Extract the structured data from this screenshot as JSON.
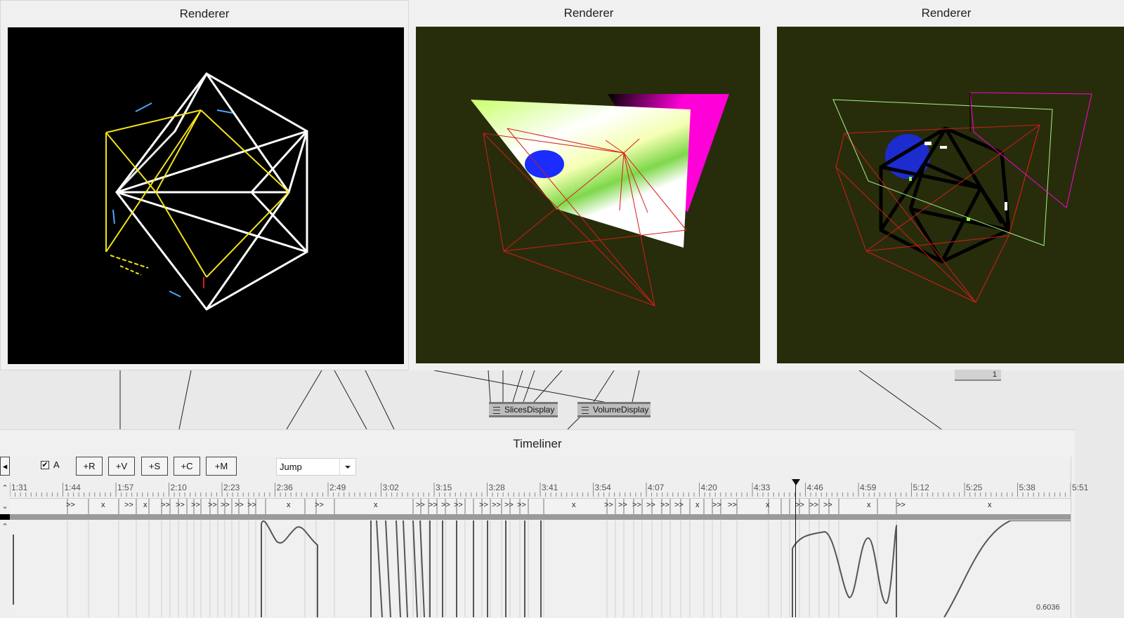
{
  "renderers": [
    {
      "title": "Renderer",
      "background": "#000000"
    },
    {
      "title": "Renderer",
      "background": "#272d0a"
    },
    {
      "title": "Renderer",
      "background": "#272d0a"
    }
  ],
  "nodes": {
    "slices_display": "SlicesDisplay",
    "volume_display": "VolumeDisplay",
    "iobox_value": "1"
  },
  "timeliner": {
    "title": "Timeliner",
    "left_button_icon": "arrow-left-icon",
    "checkbox_label": "A",
    "checkbox_checked": true,
    "buttons": [
      "+R",
      "+V",
      "+S",
      "+C",
      "+M"
    ],
    "interpolation": "Jump",
    "ruler_labels": [
      "1:31",
      "1:44",
      "1:57",
      "2:10",
      "2:23",
      "2:36",
      "2:49",
      "3:02",
      "3:15",
      "3:28",
      "3:41",
      "3:54",
      "4:07",
      "4:20",
      "4:33",
      "4:46",
      "4:59",
      "5:12",
      "5:25",
      "5:38",
      "5:51"
    ],
    "value_readout": "0.6036"
  },
  "colors": {
    "accent_red": "#d41c1c",
    "yellow_edges": "#f2e21a",
    "magenta_slice": "#ff00d8",
    "blue_blob": "#1a2cff"
  }
}
